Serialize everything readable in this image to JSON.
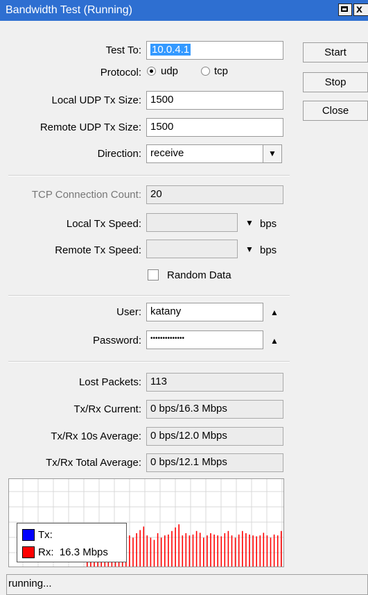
{
  "window": {
    "title": "Bandwidth Test (Running)",
    "close_glyph": "x"
  },
  "buttons": {
    "start": "Start",
    "stop": "Stop",
    "close": "Close"
  },
  "form": {
    "test_to": {
      "label": "Test To:",
      "value": "10.0.4.1"
    },
    "protocol": {
      "label": "Protocol:",
      "options": [
        "udp",
        "tcp"
      ],
      "selected": "udp"
    },
    "local_udp_tx_size": {
      "label": "Local UDP Tx Size:",
      "value": "1500"
    },
    "remote_udp_tx_size": {
      "label": "Remote UDP Tx Size:",
      "value": "1500"
    },
    "direction": {
      "label": "Direction:",
      "value": "receive"
    },
    "tcp_connection_count": {
      "label": "TCP Connection Count:",
      "value": "20"
    },
    "local_tx_speed": {
      "label": "Local Tx Speed:",
      "value": "",
      "unit": "bps"
    },
    "remote_tx_speed": {
      "label": "Remote Tx Speed:",
      "value": "",
      "unit": "bps"
    },
    "random_data": {
      "label": "Random Data",
      "checked": false
    },
    "user": {
      "label": "User:",
      "value": "katany"
    },
    "password": {
      "label": "Password:",
      "value": "••••••••••••••"
    }
  },
  "stats": {
    "lost_packets": {
      "label": "Lost Packets:",
      "value": "113"
    },
    "tx_rx_current": {
      "label": "Tx/Rx Current:",
      "value": "0 bps/16.3 Mbps"
    },
    "tx_rx_10s_average": {
      "label": "Tx/Rx 10s Average:",
      "value": "0 bps/12.0 Mbps"
    },
    "tx_rx_total_average": {
      "label": "Tx/Rx Total Average:",
      "value": "0 bps/12.1 Mbps"
    }
  },
  "chart_data": {
    "type": "bar",
    "series": [
      {
        "name": "Tx",
        "color": "#0000ff",
        "values": []
      },
      {
        "name": "Rx",
        "color": "#ff0000",
        "values": [
          0.55,
          0.6,
          0.7,
          0.62,
          0.6,
          0.58,
          0.65,
          0.7,
          0.62,
          0.6,
          0.85,
          0.78,
          0.7,
          0.65,
          0.75,
          0.82,
          0.9,
          0.7,
          0.65,
          0.6,
          0.75,
          0.65,
          0.7,
          0.72,
          0.8,
          0.88,
          0.95,
          0.7,
          0.75,
          0.7,
          0.72,
          0.8,
          0.76,
          0.65,
          0.7,
          0.75,
          0.72,
          0.7,
          0.68,
          0.75,
          0.8,
          0.7,
          0.65,
          0.72,
          0.8,
          0.75,
          0.72,
          0.7,
          0.68,
          0.7,
          0.76,
          0.7,
          0.65,
          0.72,
          0.7,
          0.8
        ]
      }
    ],
    "legend": {
      "tx_label": "Tx:",
      "tx_value": "",
      "rx_label": "Rx:",
      "rx_value": "16.3 Mbps"
    },
    "grid": true,
    "legend_position": "bottom-left"
  },
  "status": {
    "text": "running..."
  },
  "icons": {
    "dropdown": "dropdown-arrow-icon",
    "speed_dropdown": "triangle-down-icon",
    "collapse": "triangle-up-icon"
  }
}
